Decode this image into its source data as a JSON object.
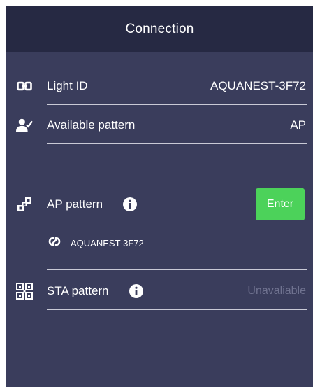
{
  "header": {
    "title": "Connection"
  },
  "light_id": {
    "icon": "link-box-icon",
    "label": "Light ID",
    "value": "AQUANEST-3F72"
  },
  "available_pattern": {
    "icon": "person-check-icon",
    "label": "Available pattern",
    "value": "AP"
  },
  "ap_pattern": {
    "icon": "pattern-blocks-icon",
    "label": "AP pattern",
    "info_icon": "info-icon",
    "button_label": "Enter",
    "ssid_icon": "link-icon",
    "ssid": "AQUANEST-3F72"
  },
  "sta_pattern": {
    "icon": "network-grid-icon",
    "label": "STA pattern",
    "info_icon": "info-icon",
    "status": "Unavaliable"
  },
  "colors": {
    "background": "#3a3d5c",
    "header": "#262943",
    "accent_green": "#4cd25a",
    "muted_text": "#707390"
  }
}
